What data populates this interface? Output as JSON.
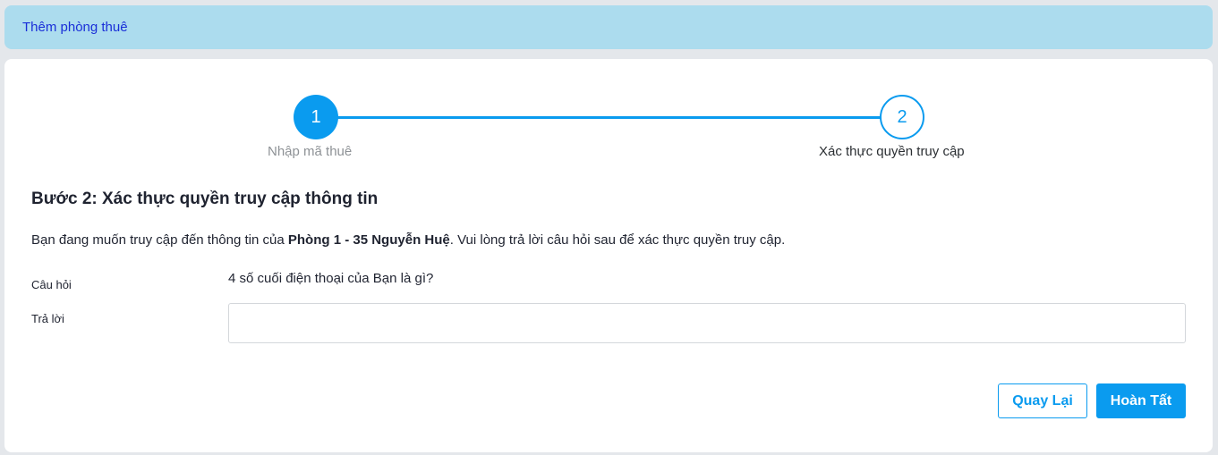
{
  "header": {
    "title": "Thêm phòng thuê"
  },
  "stepper": {
    "steps": [
      {
        "number": "1",
        "label": "Nhập mã thuê",
        "state": "completed"
      },
      {
        "number": "2",
        "label": "Xác thực quyền truy cập",
        "state": "active"
      }
    ]
  },
  "form": {
    "heading": "Bước 2: Xác thực quyền truy cập thông tin",
    "intro_prefix": "Bạn đang muốn truy cập đến thông tin của ",
    "intro_room": "Phòng 1 - 35 Nguyễn Huệ",
    "intro_suffix": ". Vui lòng trả lời câu hỏi sau để xác thực quyền truy cập.",
    "question_label": "Câu hỏi",
    "question_text": "4 số cuối điện thoại của Bạn là gì?",
    "answer_label": "Trả lời",
    "answer_value": "",
    "answer_placeholder": ""
  },
  "actions": {
    "back_label": "Quay Lại",
    "finish_label": "Hoàn Tất"
  },
  "colors": {
    "accent": "#0a9bef",
    "title_bar_bg": "#acdcee",
    "title_text": "#1a2fd8"
  }
}
